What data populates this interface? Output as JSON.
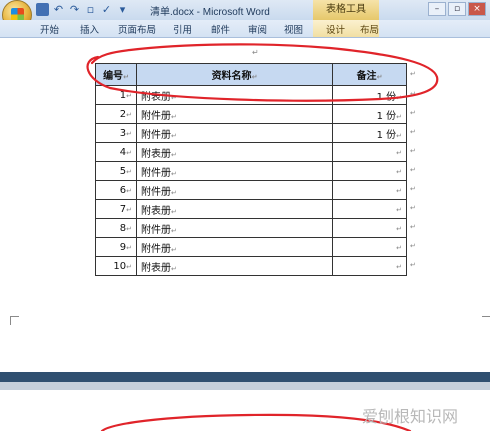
{
  "app": {
    "doc_title": "清单.docx - Microsoft Word",
    "context_tab": "表格工具"
  },
  "ribbon": {
    "tabs": [
      "开始",
      "插入",
      "页面布局",
      "引用",
      "邮件",
      "审阅",
      "视图"
    ],
    "context_tabs": [
      "设计",
      "布局"
    ]
  },
  "table": {
    "headers": [
      "编号",
      "资料名称",
      "备注"
    ],
    "rows": [
      {
        "num": "1",
        "name": "附表册",
        "note": "1 份"
      },
      {
        "num": "2",
        "name": "附件册",
        "note": "1 份"
      },
      {
        "num": "3",
        "name": "附件册",
        "note": "1 份"
      },
      {
        "num": "4",
        "name": "附表册",
        "note": ""
      },
      {
        "num": "5",
        "name": "附件册",
        "note": ""
      },
      {
        "num": "6",
        "name": "附件册",
        "note": ""
      },
      {
        "num": "7",
        "name": "附表册",
        "note": ""
      },
      {
        "num": "8",
        "name": "附件册",
        "note": ""
      },
      {
        "num": "9",
        "name": "附件册",
        "note": ""
      },
      {
        "num": "10",
        "name": "附表册",
        "note": ""
      }
    ]
  },
  "watermark": "爱刨根知识网",
  "colors": {
    "header_fill": "#c6d9f1",
    "annotation": "#e0242a",
    "context_tab": "#e6c86b"
  }
}
